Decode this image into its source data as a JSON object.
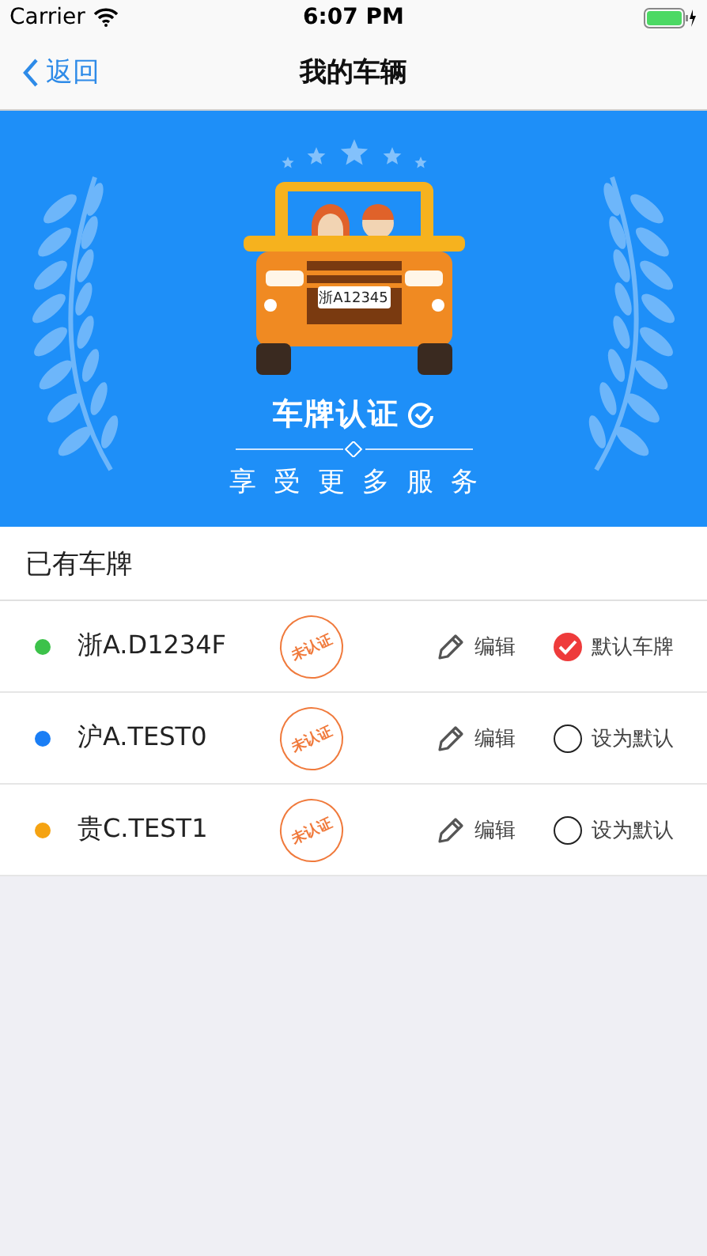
{
  "status_bar": {
    "carrier": "Carrier",
    "time": "6:07 PM"
  },
  "nav": {
    "back": "返回",
    "title": "我的车辆"
  },
  "banner": {
    "plate": "浙A12345",
    "title": "车牌认证",
    "subtitle": "享受更多服务"
  },
  "section": {
    "title": "已有车牌"
  },
  "plates": [
    {
      "color": "#3cc24a",
      "number": "浙A.D1234F",
      "stamp": "未认证",
      "edit": "编辑",
      "default": true,
      "default_label": "默认车牌"
    },
    {
      "color": "#1a7ef5",
      "number": "沪A.TEST0",
      "stamp": "未认证",
      "edit": "编辑",
      "default": false,
      "default_label": "设为默认"
    },
    {
      "color": "#f5a312",
      "number": "贵C.TEST1",
      "stamp": "未认证",
      "edit": "编辑",
      "default": false,
      "default_label": "设为默认"
    }
  ]
}
